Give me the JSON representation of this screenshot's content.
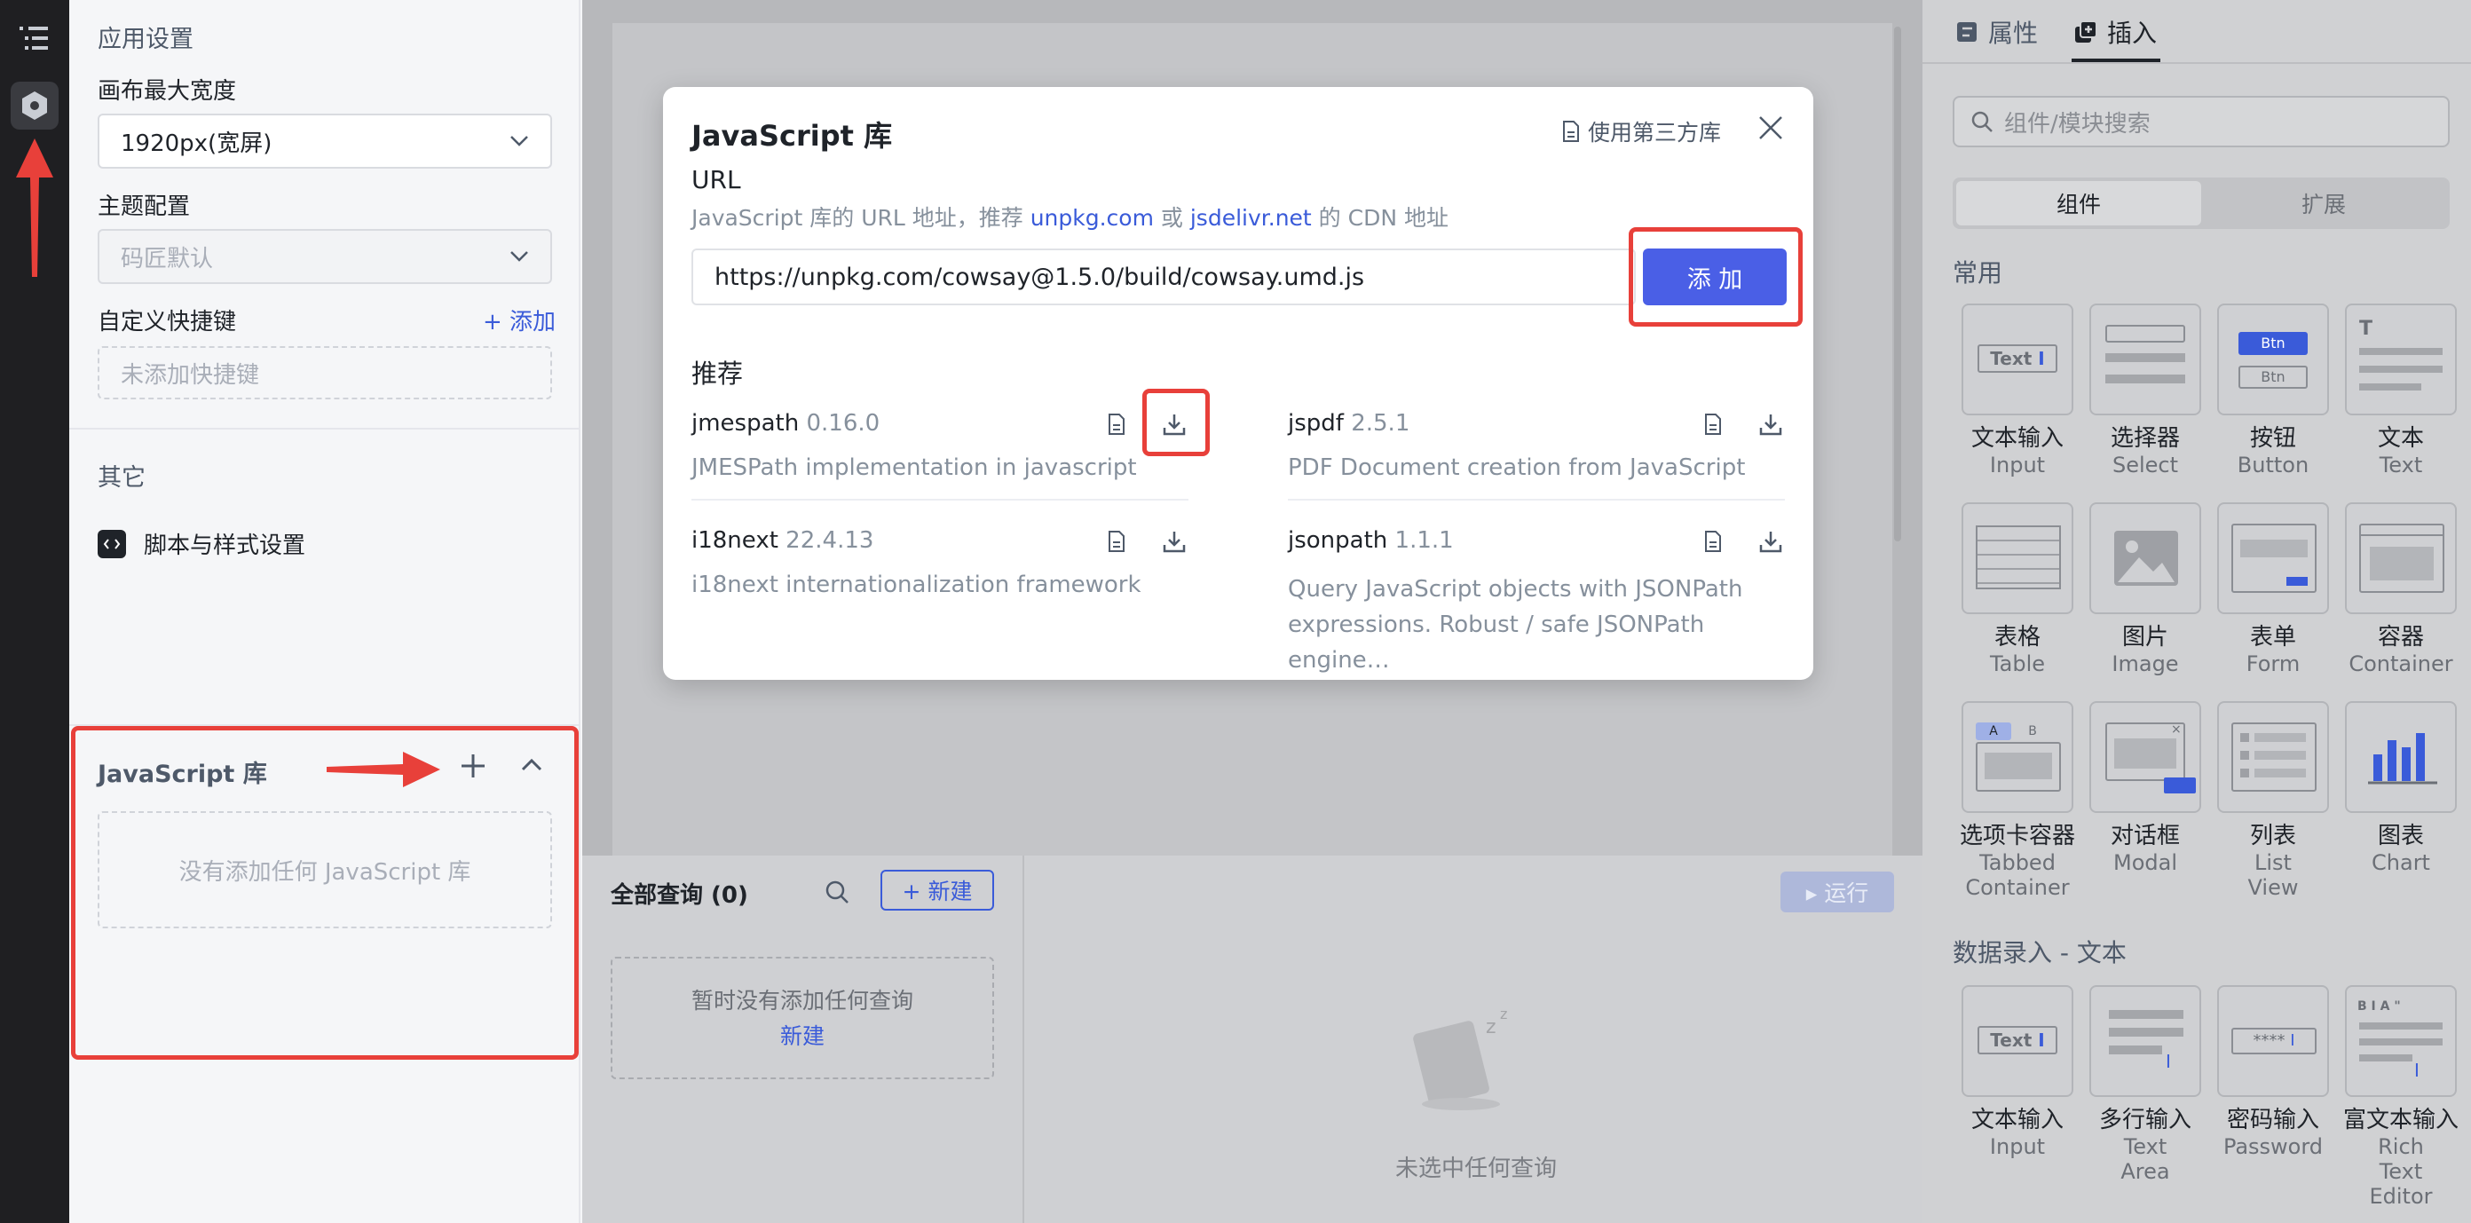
{
  "rail": {
    "icons": [
      "outline-icon",
      "settings-hex-icon"
    ]
  },
  "settings": {
    "app_section": "应用设置",
    "canvas_width_label": "画布最大宽度",
    "canvas_width_value": "1920px(宽屏)",
    "theme_label": "主题配置",
    "theme_value": "码匠默认",
    "shortcut_label": "自定义快捷键",
    "shortcut_add": "+ 添加",
    "shortcut_empty": "未添加快捷键",
    "other_section": "其它",
    "script_style": "脚本与样式设置",
    "jslib_title": "JavaScript 库",
    "jslib_empty": "没有添加任何 JavaScript 库"
  },
  "modal": {
    "title": "JavaScript 库",
    "third_party": "使用第三方库",
    "url_label": "URL",
    "url_help_prefix": "JavaScript 库的 URL 地址，推荐 ",
    "url_help_link1": "unpkg.com",
    "url_help_or": " 或 ",
    "url_help_link2": "jsdelivr.net",
    "url_help_suffix": " 的 CDN 地址",
    "url_value": "https://unpkg.com/cowsay@1.5.0/build/cowsay.umd.js",
    "add_button": "添 加",
    "recommend_title": "推荐",
    "recommendations": [
      {
        "name": "jmespath",
        "version": "0.16.0",
        "desc": "JMESPath implementation in javascript"
      },
      {
        "name": "jspdf",
        "version": "2.5.1",
        "desc": "PDF Document creation from JavaScript"
      },
      {
        "name": "i18next",
        "version": "22.4.13",
        "desc": "i18next internationalization framework"
      },
      {
        "name": "jsonpath",
        "version": "1.1.1",
        "desc": "Query JavaScript objects with JSONPath expressions. Robust / safe JSONPath engine…"
      }
    ]
  },
  "query": {
    "title": "全部查询 (0)",
    "new_button": "+ 新建",
    "run_button": "▸ 运行",
    "empty_text": "暂时没有添加任何查询",
    "empty_link": "新建",
    "no_selection": "未选中任何查询"
  },
  "right": {
    "tab_props": "属性",
    "tab_insert": "插入",
    "search_placeholder": "组件/模块搜索",
    "seg_components": "组件",
    "seg_extensions": "扩展",
    "common_title": "常用",
    "common": [
      {
        "name": "文本输入",
        "sub": "Input",
        "icon": "text-input-icon"
      },
      {
        "name": "选择器",
        "sub": "Select",
        "icon": "select-icon"
      },
      {
        "name": "按钮",
        "sub": "Button",
        "icon": "button-icon"
      },
      {
        "name": "文本",
        "sub": "Text",
        "icon": "text-icon"
      },
      {
        "name": "表格",
        "sub": "Table",
        "icon": "table-icon"
      },
      {
        "name": "图片",
        "sub": "Image",
        "icon": "image-icon"
      },
      {
        "name": "表单",
        "sub": "Form",
        "icon": "form-icon"
      },
      {
        "name": "容器",
        "sub": "Container",
        "icon": "container-icon"
      },
      {
        "name": "选项卡容器",
        "sub": "Tabbed Container",
        "icon": "tabs-icon"
      },
      {
        "name": "对话框",
        "sub": "Modal",
        "icon": "modal-icon"
      },
      {
        "name": "列表",
        "sub": "List View",
        "icon": "list-icon"
      },
      {
        "name": "图表",
        "sub": "Chart",
        "icon": "chart-icon"
      }
    ],
    "data_entry_title": "数据录入 - 文本",
    "data_entry": [
      {
        "name": "文本输入",
        "sub": "Input",
        "icon": "text-input-icon"
      },
      {
        "name": "多行输入",
        "sub": "Text Area",
        "icon": "textarea-icon"
      },
      {
        "name": "密码输入",
        "sub": "Password",
        "icon": "password-icon"
      },
      {
        "name": "富文本输入",
        "sub": "Rich Text Editor",
        "icon": "rich-text-icon"
      }
    ]
  },
  "colors": {
    "accent": "#3a5bd9",
    "primary_button": "#4a5fe6",
    "annotation": "#e8403a"
  }
}
